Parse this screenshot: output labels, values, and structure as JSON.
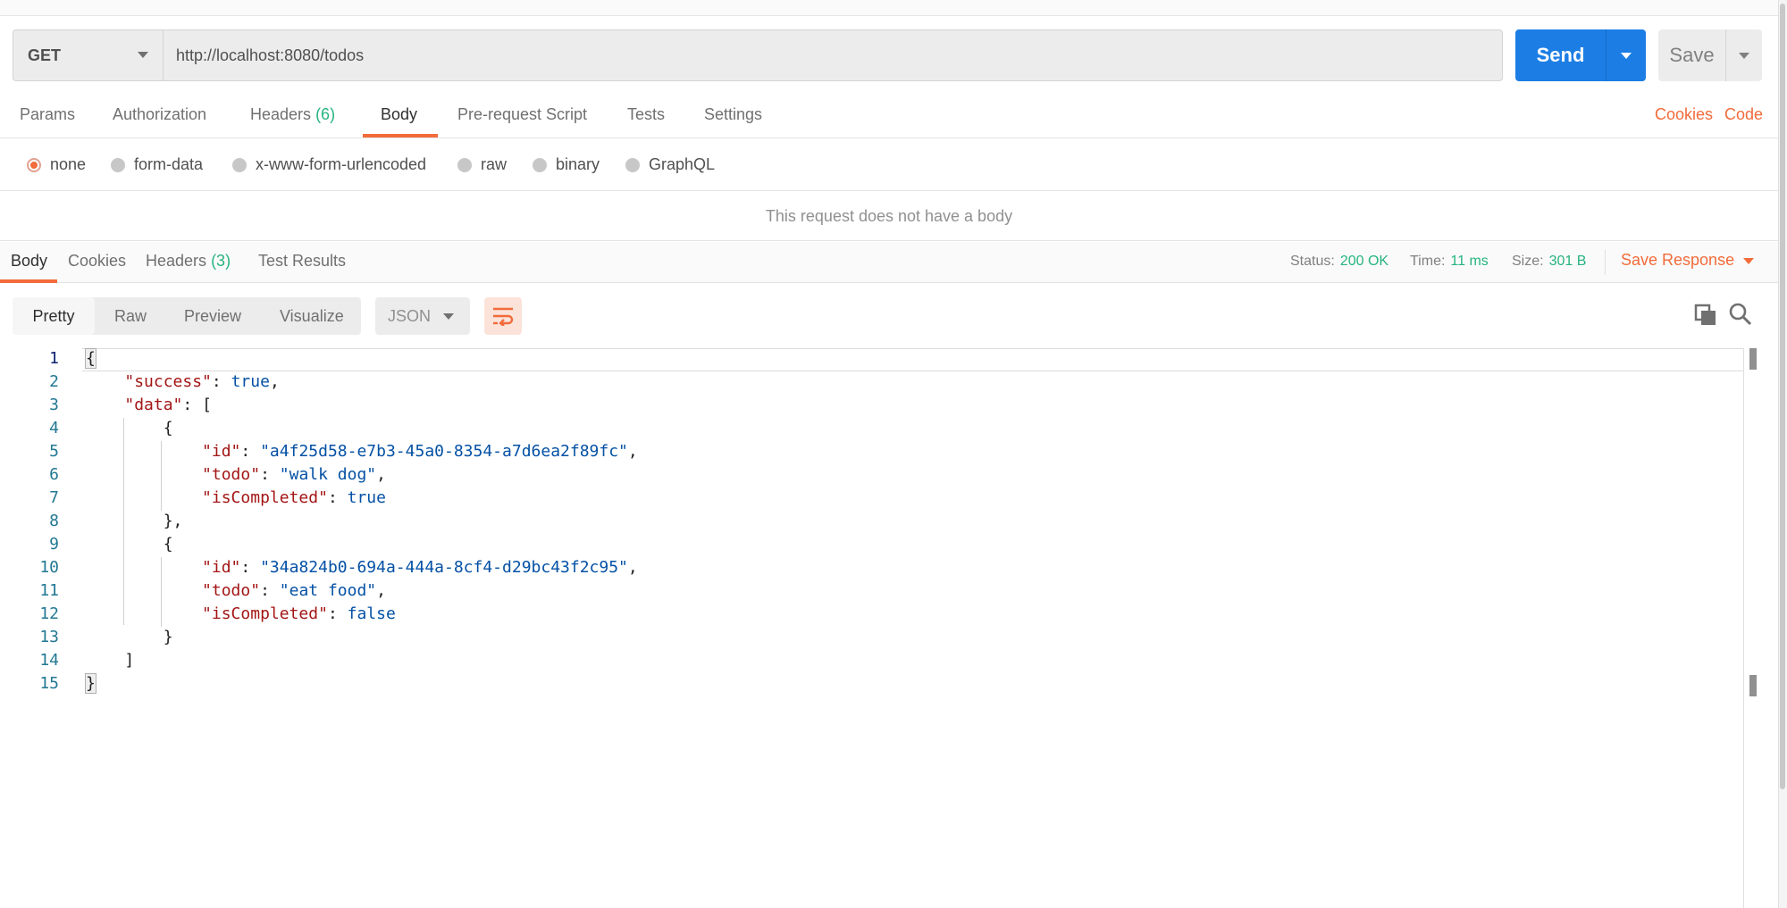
{
  "request": {
    "method": "GET",
    "url": "http://localhost:8080/todos",
    "send_label": "Send",
    "save_label": "Save"
  },
  "request_tabs": {
    "params": "Params",
    "authorization": "Authorization",
    "headers": "Headers",
    "headers_count": "(6)",
    "body": "Body",
    "prerequest": "Pre-request Script",
    "tests": "Tests",
    "settings": "Settings",
    "cookies": "Cookies",
    "code": "Code"
  },
  "body_types": {
    "none": "none",
    "form_data": "form-data",
    "urlencoded": "x-www-form-urlencoded",
    "raw": "raw",
    "binary": "binary",
    "graphql": "GraphQL",
    "selected": "none"
  },
  "no_body_message": "This request does not have a body",
  "response_tabs": {
    "body": "Body",
    "cookies": "Cookies",
    "headers": "Headers",
    "headers_count": "(3)",
    "test_results": "Test Results"
  },
  "response_status": {
    "status_label": "Status:",
    "status_value": "200 OK",
    "time_label": "Time:",
    "time_value": "11 ms",
    "size_label": "Size:",
    "size_value": "301 B",
    "save_response": "Save Response"
  },
  "view_options": {
    "pretty": "Pretty",
    "raw": "Raw",
    "preview": "Preview",
    "visualize": "Visualize",
    "format": "JSON"
  },
  "icons": {
    "wrap": "wrap-lines-icon",
    "copy": "copy-icon",
    "search": "search-icon"
  },
  "colors": {
    "accent": "#f26b3a",
    "primary": "#1c7ee5",
    "success": "#26b47f"
  },
  "editor": {
    "line_numbers": [
      "1",
      "2",
      "3",
      "4",
      "5",
      "6",
      "7",
      "8",
      "9",
      "10",
      "11",
      "12",
      "13",
      "14",
      "15"
    ],
    "lines": [
      {
        "indent": "",
        "parts": [
          {
            "t": "p",
            "v": "{"
          }
        ]
      },
      {
        "indent": "    ",
        "parts": [
          {
            "t": "k",
            "v": "\"success\""
          },
          {
            "t": "p",
            "v": ": "
          },
          {
            "t": "b",
            "v": "true"
          },
          {
            "t": "p",
            "v": ","
          }
        ]
      },
      {
        "indent": "    ",
        "parts": [
          {
            "t": "k",
            "v": "\"data\""
          },
          {
            "t": "p",
            "v": ": ["
          }
        ]
      },
      {
        "indent": "        ",
        "parts": [
          {
            "t": "p",
            "v": "{"
          }
        ]
      },
      {
        "indent": "            ",
        "parts": [
          {
            "t": "k",
            "v": "\"id\""
          },
          {
            "t": "p",
            "v": ": "
          },
          {
            "t": "s",
            "v": "\"a4f25d58-e7b3-45a0-8354-a7d6ea2f89fc\""
          },
          {
            "t": "p",
            "v": ","
          }
        ]
      },
      {
        "indent": "            ",
        "parts": [
          {
            "t": "k",
            "v": "\"todo\""
          },
          {
            "t": "p",
            "v": ": "
          },
          {
            "t": "s",
            "v": "\"walk dog\""
          },
          {
            "t": "p",
            "v": ","
          }
        ]
      },
      {
        "indent": "            ",
        "parts": [
          {
            "t": "k",
            "v": "\"isCompleted\""
          },
          {
            "t": "p",
            "v": ": "
          },
          {
            "t": "b",
            "v": "true"
          }
        ]
      },
      {
        "indent": "        ",
        "parts": [
          {
            "t": "p",
            "v": "},"
          }
        ]
      },
      {
        "indent": "        ",
        "parts": [
          {
            "t": "p",
            "v": "{"
          }
        ]
      },
      {
        "indent": "            ",
        "parts": [
          {
            "t": "k",
            "v": "\"id\""
          },
          {
            "t": "p",
            "v": ": "
          },
          {
            "t": "s",
            "v": "\"34a824b0-694a-444a-8cf4-d29bc43f2c95\""
          },
          {
            "t": "p",
            "v": ","
          }
        ]
      },
      {
        "indent": "            ",
        "parts": [
          {
            "t": "k",
            "v": "\"todo\""
          },
          {
            "t": "p",
            "v": ": "
          },
          {
            "t": "s",
            "v": "\"eat food\""
          },
          {
            "t": "p",
            "v": ","
          }
        ]
      },
      {
        "indent": "            ",
        "parts": [
          {
            "t": "k",
            "v": "\"isCompleted\""
          },
          {
            "t": "p",
            "v": ": "
          },
          {
            "t": "b",
            "v": "false"
          }
        ]
      },
      {
        "indent": "        ",
        "parts": [
          {
            "t": "p",
            "v": "}"
          }
        ]
      },
      {
        "indent": "    ",
        "parts": [
          {
            "t": "p",
            "v": "]"
          }
        ]
      },
      {
        "indent": "",
        "parts": [
          {
            "t": "p",
            "v": "}"
          }
        ]
      }
    ]
  }
}
